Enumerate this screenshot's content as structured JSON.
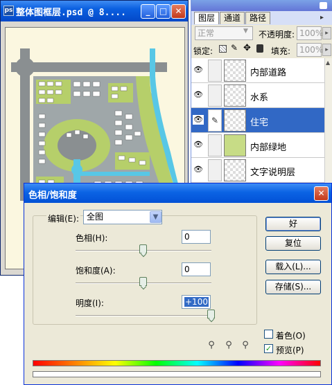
{
  "doc_window": {
    "title": "整体图框层.psd @ 8....",
    "icon": "ps",
    "controls": {
      "minimize": "_",
      "maximize": "□",
      "close": "✕"
    }
  },
  "layers_panel": {
    "tabs": [
      {
        "label": "图层",
        "active": true
      },
      {
        "label": "通道",
        "active": false
      },
      {
        "label": "路径",
        "active": false
      }
    ],
    "blend_mode": "正常",
    "opacity_label": "不透明度:",
    "opacity_value": "100%",
    "lock_label": "锁定:",
    "fill_label": "填充:",
    "fill_value": "100%",
    "layers": [
      {
        "name": "内部道路",
        "selected": false
      },
      {
        "name": "水系",
        "selected": false
      },
      {
        "name": "住宅",
        "selected": true
      },
      {
        "name": "内部绿地",
        "selected": false
      },
      {
        "name": "文字说明层",
        "selected": false
      }
    ]
  },
  "dialog": {
    "title": "色相/饱和度",
    "edit_label": "编辑(E):",
    "edit_value": "全图",
    "hue_label": "色相(H):",
    "hue_value": "0",
    "saturation_label": "饱和度(A):",
    "saturation_value": "0",
    "lightness_label": "明度(I):",
    "lightness_value": "+100",
    "sliders": {
      "hue": 0.5,
      "saturation": 0.5,
      "lightness": 1.0
    },
    "buttons": {
      "ok": "好",
      "reset": "复位",
      "load": "载入(L)...",
      "save": "存储(S)..."
    },
    "colorize_label": "着色(O)",
    "colorize_checked": false,
    "preview_label": "预览(P)",
    "preview_checked": true
  },
  "colors": {
    "xp_blue": "#0a5fe0",
    "selection": "#3168c5",
    "dialog_bg": "#ece9d8",
    "canvas_bg": "#fbf7e0",
    "green": "#b6cf6a",
    "water": "#58c7e6",
    "road": "#8a8f91"
  }
}
